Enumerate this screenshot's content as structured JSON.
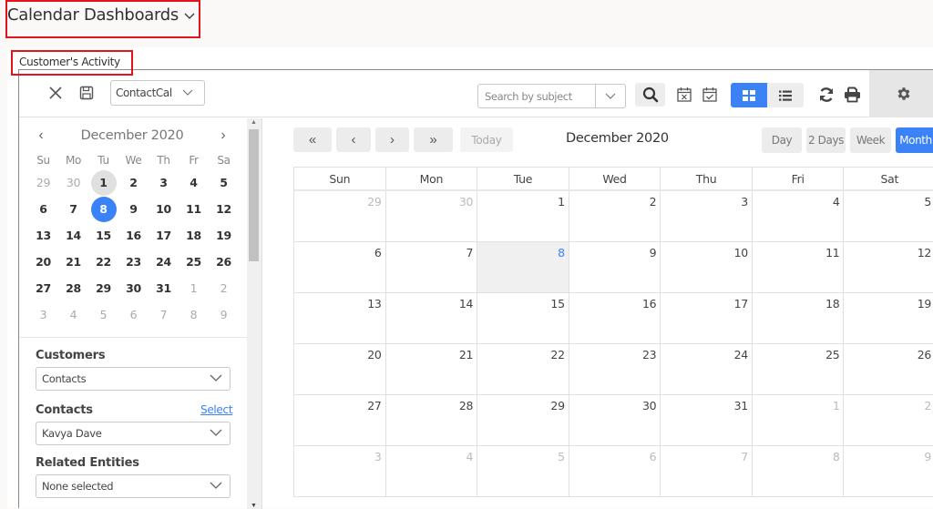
{
  "page": {
    "title": "Calendar Dashboards",
    "card_title": "Customer's Activity"
  },
  "toolbar": {
    "calendar_select": "ContactCal",
    "search_placeholder": "Search by subject",
    "icons": [
      "close-icon",
      "save-icon",
      "search-icon",
      "calendar-x-icon",
      "calendar-check-icon",
      "grid-view-icon",
      "list-view-icon",
      "refresh-icon",
      "print-icon",
      "gear-icon"
    ]
  },
  "mini_calendar": {
    "month_label": "December 2020",
    "prev": "‹",
    "next": "›",
    "dow": [
      "Su",
      "Mo",
      "Tu",
      "We",
      "Th",
      "Fr",
      "Sa"
    ],
    "weeks": [
      [
        {
          "d": "29",
          "o": true
        },
        {
          "d": "30",
          "o": true
        },
        {
          "d": "1",
          "first": true
        },
        {
          "d": "2"
        },
        {
          "d": "3"
        },
        {
          "d": "4"
        },
        {
          "d": "5"
        }
      ],
      [
        {
          "d": "6"
        },
        {
          "d": "7"
        },
        {
          "d": "8",
          "sel": true
        },
        {
          "d": "9"
        },
        {
          "d": "10"
        },
        {
          "d": "11"
        },
        {
          "d": "12"
        }
      ],
      [
        {
          "d": "13"
        },
        {
          "d": "14"
        },
        {
          "d": "15"
        },
        {
          "d": "16"
        },
        {
          "d": "17"
        },
        {
          "d": "18"
        },
        {
          "d": "19"
        }
      ],
      [
        {
          "d": "20"
        },
        {
          "d": "21"
        },
        {
          "d": "22"
        },
        {
          "d": "23"
        },
        {
          "d": "24"
        },
        {
          "d": "25"
        },
        {
          "d": "26"
        }
      ],
      [
        {
          "d": "27"
        },
        {
          "d": "28"
        },
        {
          "d": "29"
        },
        {
          "d": "30"
        },
        {
          "d": "31"
        },
        {
          "d": "1",
          "o": true
        },
        {
          "d": "2",
          "o": true
        }
      ],
      [
        {
          "d": "3",
          "o": true
        },
        {
          "d": "4",
          "o": true
        },
        {
          "d": "5",
          "o": true
        },
        {
          "d": "6",
          "o": true
        },
        {
          "d": "7",
          "o": true
        },
        {
          "d": "8",
          "o": true
        },
        {
          "d": "9",
          "o": true
        }
      ]
    ]
  },
  "filters": {
    "customers_label": "Customers",
    "customers_value": "Contacts",
    "contacts_label": "Contacts",
    "contacts_select_link": "Select",
    "contacts_value": "Kavya Dave",
    "related_label": "Related Entities",
    "related_value": "None selected"
  },
  "main": {
    "nav": {
      "first": "«",
      "prev": "‹",
      "next": "›",
      "last": "»",
      "today": "Today"
    },
    "month_label": "December 2020",
    "views": [
      {
        "label": "Day",
        "active": false
      },
      {
        "label": "2 Days",
        "active": false
      },
      {
        "label": "Week",
        "active": false
      },
      {
        "label": "Month",
        "active": true
      }
    ],
    "dow": [
      "Sun",
      "Mon",
      "Tue",
      "Wed",
      "Thu",
      "Fri",
      "Sat"
    ],
    "weeks": [
      [
        {
          "d": "29",
          "o": true
        },
        {
          "d": "30",
          "o": true
        },
        {
          "d": "1"
        },
        {
          "d": "2"
        },
        {
          "d": "3"
        },
        {
          "d": "4"
        },
        {
          "d": "5"
        }
      ],
      [
        {
          "d": "6"
        },
        {
          "d": "7"
        },
        {
          "d": "8",
          "today": true
        },
        {
          "d": "9"
        },
        {
          "d": "10"
        },
        {
          "d": "11"
        },
        {
          "d": "12"
        }
      ],
      [
        {
          "d": "13"
        },
        {
          "d": "14"
        },
        {
          "d": "15"
        },
        {
          "d": "16"
        },
        {
          "d": "17"
        },
        {
          "d": "18"
        },
        {
          "d": "19"
        }
      ],
      [
        {
          "d": "20"
        },
        {
          "d": "21"
        },
        {
          "d": "22"
        },
        {
          "d": "23"
        },
        {
          "d": "24"
        },
        {
          "d": "25"
        },
        {
          "d": "26"
        }
      ],
      [
        {
          "d": "27"
        },
        {
          "d": "28"
        },
        {
          "d": "29"
        },
        {
          "d": "30"
        },
        {
          "d": "31"
        },
        {
          "d": "1",
          "o": true
        },
        {
          "d": "2",
          "o": true
        }
      ],
      [
        {
          "d": "3",
          "o": true
        },
        {
          "d": "4",
          "o": true
        },
        {
          "d": "5",
          "o": true
        },
        {
          "d": "6",
          "o": true
        },
        {
          "d": "7",
          "o": true
        },
        {
          "d": "8",
          "o": true
        },
        {
          "d": "9",
          "o": true
        }
      ]
    ]
  },
  "colors": {
    "accent": "#3b82f6",
    "highlight_box": "#e3131b"
  }
}
